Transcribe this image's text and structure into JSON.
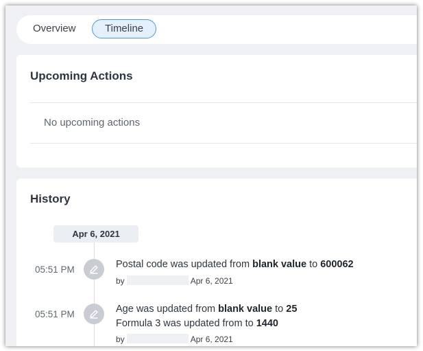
{
  "tabs": [
    {
      "label": "Overview",
      "active": false
    },
    {
      "label": "Timeline",
      "active": true
    }
  ],
  "upcoming": {
    "title": "Upcoming Actions",
    "empty_text": "No upcoming actions"
  },
  "history": {
    "title": "History",
    "date_chip": "Apr 6, 2021",
    "entries": [
      {
        "time": "05:51 PM",
        "icon": "pencil-icon",
        "lines": [
          {
            "pre": "Postal code was updated from ",
            "from": "blank value",
            "mid": " to ",
            "to": "600062"
          }
        ],
        "by_prefix": "by",
        "by_date": "Apr 6, 2021"
      },
      {
        "time": "05:51 PM",
        "icon": "pencil-icon",
        "lines": [
          {
            "pre": "Age was updated from ",
            "from": "blank value",
            "mid": " to ",
            "to": "25"
          },
          {
            "pre": "Formula 3 was updated from to ",
            "to": "1440"
          }
        ],
        "by_prefix": "by",
        "by_date": "Apr 6, 2021"
      }
    ]
  },
  "colors": {
    "accent": "#4a9ae0",
    "active_tab_bg": "#e4f0fb",
    "icon_circle": "#c9cdd3",
    "page_bg": "#eef0f3"
  }
}
